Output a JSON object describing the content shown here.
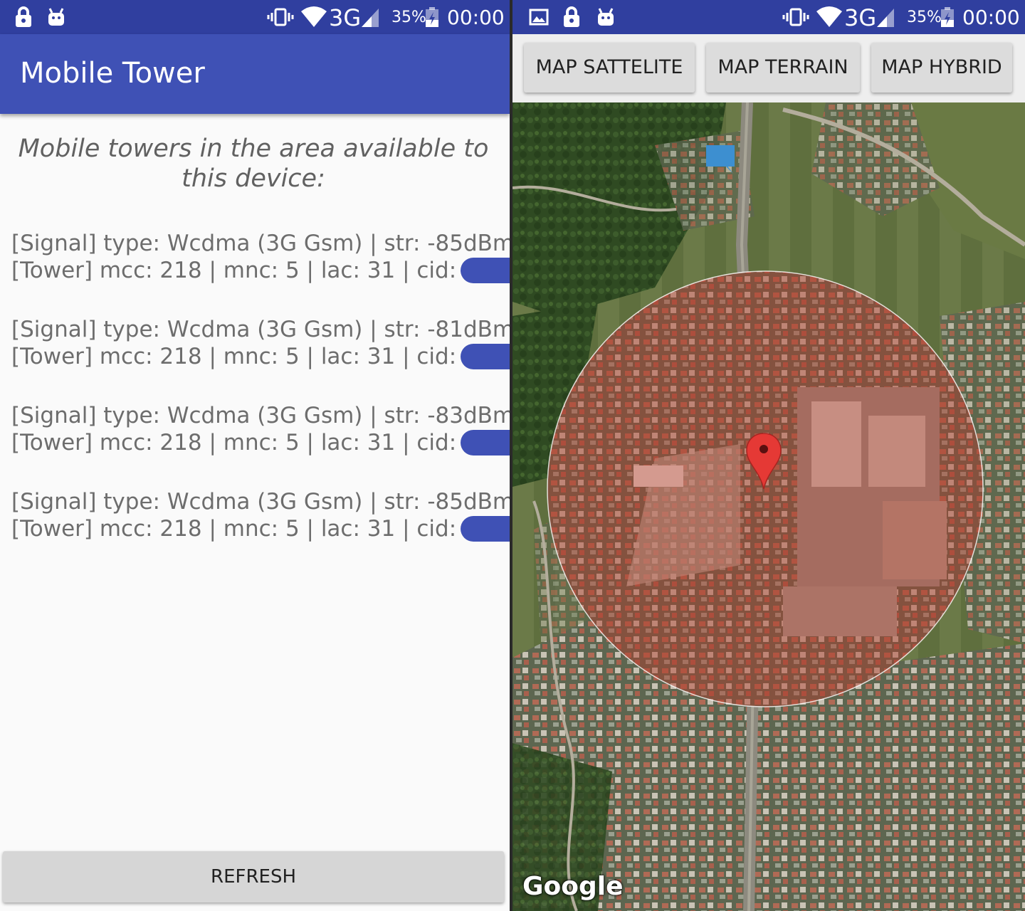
{
  "status_left": {
    "network": "3G",
    "battery": "35%",
    "time": "00:00"
  },
  "status_right": {
    "network": "3G",
    "battery": "35%",
    "time": "00:00"
  },
  "app": {
    "title": "Mobile Tower",
    "heading": "Mobile towers in the area available to this device:",
    "refresh_label": "REFRESH"
  },
  "towers": [
    {
      "signal": "[Signal] type: Wcdma (3G Gsm) | str:  -85dBm",
      "tower": "[Tower] mcc: 218 | mnc: 5 | lac: 31 | cid:"
    },
    {
      "signal": "[Signal] type: Wcdma (3G Gsm) | str:  -81dBm",
      "tower": "[Tower] mcc: 218 | mnc: 5 | lac: 31 | cid:"
    },
    {
      "signal": "[Signal] type: Wcdma (3G Gsm) | str:  -83dBm",
      "tower": "[Tower] mcc: 218 | mnc: 5 | lac: 31 | cid:"
    },
    {
      "signal": "[Signal] type: Wcdma (3G Gsm) | str:  -85dBm",
      "tower": "[Tower] mcc: 218 | mnc: 5 | lac: 31 | cid:"
    }
  ],
  "map": {
    "buttons": {
      "satellite": "MAP SATTELITE",
      "terrain": "MAP TERRAIN",
      "hybrid": "MAP HYBRID"
    },
    "attribution": "Google",
    "accent": "#3f51b5",
    "statusbar_color": "#303f9f",
    "marker_color": "#e53935"
  }
}
